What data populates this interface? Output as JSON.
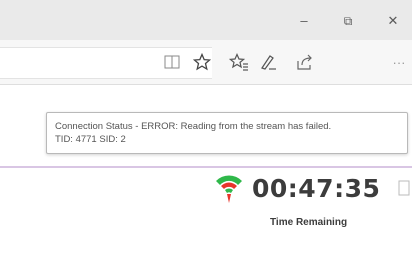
{
  "window": {
    "controls": {
      "minimize": "–",
      "restore": "⧉",
      "close": "✕"
    }
  },
  "toolbar": {
    "icons": [
      "reading-view-icon",
      "favorite-star-icon",
      "favorites-hub-icon",
      "web-note-icon",
      "share-icon",
      "more-icon"
    ],
    "more_label": "···"
  },
  "tooltip": {
    "line1": "Connection Status - ERROR: Reading from the stream has failed.",
    "line2": "TID: 4771 SID: 2"
  },
  "timer": {
    "value": "00:47:35",
    "label": "Time Remaining"
  },
  "colors": {
    "signal_green": "#2fb84a",
    "signal_red": "#e8352c",
    "accent_line": "#d9c6e4"
  }
}
